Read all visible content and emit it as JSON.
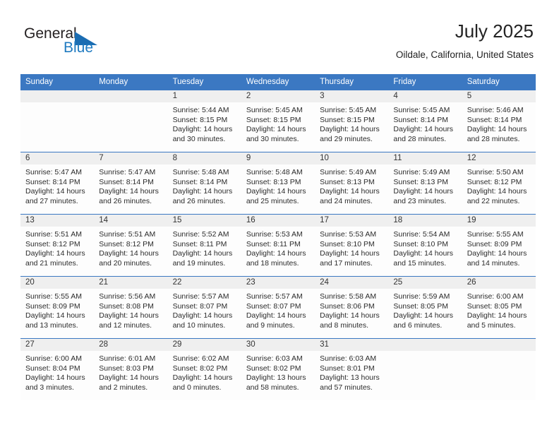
{
  "brand": {
    "name_part1": "General",
    "name_part2": "Blue",
    "triangle_icon": "triangle-icon",
    "colors": {
      "dark": "#231f20",
      "blue": "#1f7ac0",
      "header_blue": "#3b78c2",
      "band_gray": "#efefef"
    }
  },
  "header": {
    "title": "July 2025",
    "subtitle": "Oildale, California, United States"
  },
  "weekdays": [
    "Sunday",
    "Monday",
    "Tuesday",
    "Wednesday",
    "Thursday",
    "Friday",
    "Saturday"
  ],
  "labels": {
    "sunrise": "Sunrise:",
    "sunset": "Sunset:",
    "daylight": "Daylight:"
  },
  "weeks": [
    [
      {
        "day": "",
        "lines": ""
      },
      {
        "day": "",
        "lines": ""
      },
      {
        "day": "1",
        "lines": "Sunrise: 5:44 AM\nSunset: 8:15 PM\nDaylight: 14 hours and 30 minutes."
      },
      {
        "day": "2",
        "lines": "Sunrise: 5:45 AM\nSunset: 8:15 PM\nDaylight: 14 hours and 30 minutes."
      },
      {
        "day": "3",
        "lines": "Sunrise: 5:45 AM\nSunset: 8:15 PM\nDaylight: 14 hours and 29 minutes."
      },
      {
        "day": "4",
        "lines": "Sunrise: 5:45 AM\nSunset: 8:14 PM\nDaylight: 14 hours and 28 minutes."
      },
      {
        "day": "5",
        "lines": "Sunrise: 5:46 AM\nSunset: 8:14 PM\nDaylight: 14 hours and 28 minutes."
      }
    ],
    [
      {
        "day": "6",
        "lines": "Sunrise: 5:47 AM\nSunset: 8:14 PM\nDaylight: 14 hours and 27 minutes."
      },
      {
        "day": "7",
        "lines": "Sunrise: 5:47 AM\nSunset: 8:14 PM\nDaylight: 14 hours and 26 minutes."
      },
      {
        "day": "8",
        "lines": "Sunrise: 5:48 AM\nSunset: 8:14 PM\nDaylight: 14 hours and 26 minutes."
      },
      {
        "day": "9",
        "lines": "Sunrise: 5:48 AM\nSunset: 8:13 PM\nDaylight: 14 hours and 25 minutes."
      },
      {
        "day": "10",
        "lines": "Sunrise: 5:49 AM\nSunset: 8:13 PM\nDaylight: 14 hours and 24 minutes."
      },
      {
        "day": "11",
        "lines": "Sunrise: 5:49 AM\nSunset: 8:13 PM\nDaylight: 14 hours and 23 minutes."
      },
      {
        "day": "12",
        "lines": "Sunrise: 5:50 AM\nSunset: 8:12 PM\nDaylight: 14 hours and 22 minutes."
      }
    ],
    [
      {
        "day": "13",
        "lines": "Sunrise: 5:51 AM\nSunset: 8:12 PM\nDaylight: 14 hours and 21 minutes."
      },
      {
        "day": "14",
        "lines": "Sunrise: 5:51 AM\nSunset: 8:12 PM\nDaylight: 14 hours and 20 minutes."
      },
      {
        "day": "15",
        "lines": "Sunrise: 5:52 AM\nSunset: 8:11 PM\nDaylight: 14 hours and 19 minutes."
      },
      {
        "day": "16",
        "lines": "Sunrise: 5:53 AM\nSunset: 8:11 PM\nDaylight: 14 hours and 18 minutes."
      },
      {
        "day": "17",
        "lines": "Sunrise: 5:53 AM\nSunset: 8:10 PM\nDaylight: 14 hours and 17 minutes."
      },
      {
        "day": "18",
        "lines": "Sunrise: 5:54 AM\nSunset: 8:10 PM\nDaylight: 14 hours and 15 minutes."
      },
      {
        "day": "19",
        "lines": "Sunrise: 5:55 AM\nSunset: 8:09 PM\nDaylight: 14 hours and 14 minutes."
      }
    ],
    [
      {
        "day": "20",
        "lines": "Sunrise: 5:55 AM\nSunset: 8:09 PM\nDaylight: 14 hours and 13 minutes."
      },
      {
        "day": "21",
        "lines": "Sunrise: 5:56 AM\nSunset: 8:08 PM\nDaylight: 14 hours and 12 minutes."
      },
      {
        "day": "22",
        "lines": "Sunrise: 5:57 AM\nSunset: 8:07 PM\nDaylight: 14 hours and 10 minutes."
      },
      {
        "day": "23",
        "lines": "Sunrise: 5:57 AM\nSunset: 8:07 PM\nDaylight: 14 hours and 9 minutes."
      },
      {
        "day": "24",
        "lines": "Sunrise: 5:58 AM\nSunset: 8:06 PM\nDaylight: 14 hours and 8 minutes."
      },
      {
        "day": "25",
        "lines": "Sunrise: 5:59 AM\nSunset: 8:05 PM\nDaylight: 14 hours and 6 minutes."
      },
      {
        "day": "26",
        "lines": "Sunrise: 6:00 AM\nSunset: 8:05 PM\nDaylight: 14 hours and 5 minutes."
      }
    ],
    [
      {
        "day": "27",
        "lines": "Sunrise: 6:00 AM\nSunset: 8:04 PM\nDaylight: 14 hours and 3 minutes."
      },
      {
        "day": "28",
        "lines": "Sunrise: 6:01 AM\nSunset: 8:03 PM\nDaylight: 14 hours and 2 minutes."
      },
      {
        "day": "29",
        "lines": "Sunrise: 6:02 AM\nSunset: 8:02 PM\nDaylight: 14 hours and 0 minutes."
      },
      {
        "day": "30",
        "lines": "Sunrise: 6:03 AM\nSunset: 8:02 PM\nDaylight: 13 hours and 58 minutes."
      },
      {
        "day": "31",
        "lines": "Sunrise: 6:03 AM\nSunset: 8:01 PM\nDaylight: 13 hours and 57 minutes."
      },
      {
        "day": "",
        "lines": ""
      },
      {
        "day": "",
        "lines": ""
      }
    ]
  ]
}
